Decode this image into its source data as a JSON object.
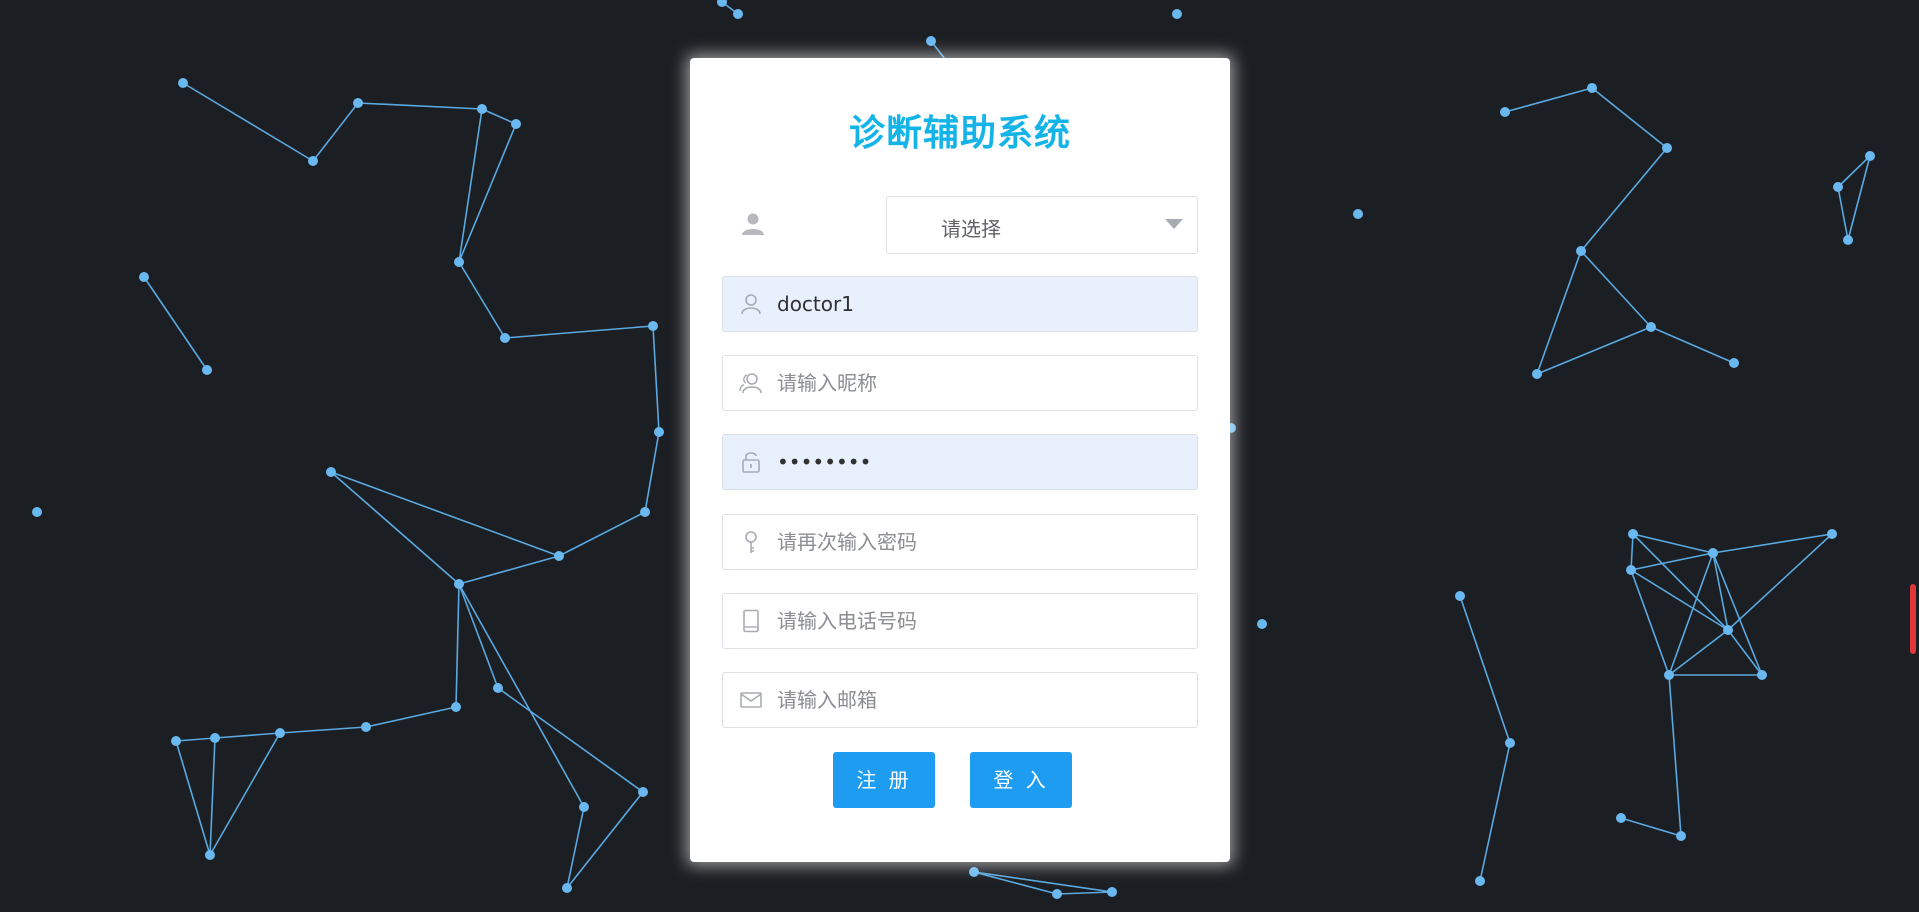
{
  "app": {
    "title": "诊断辅助系统"
  },
  "role_select": {
    "value": "请选择",
    "icon": "user-solid-icon"
  },
  "fields": {
    "username": {
      "value": "doctor1",
      "placeholder": "",
      "icon": "user-icon"
    },
    "nickname": {
      "value": "",
      "placeholder": "请输入昵称",
      "icon": "users-icon"
    },
    "password": {
      "value": "••••••••",
      "placeholder": "",
      "icon": "lock-icon"
    },
    "confirm_password": {
      "value": "",
      "placeholder": "请再次输入密码",
      "icon": "key-icon"
    },
    "phone": {
      "value": "",
      "placeholder": "请输入电话号码",
      "icon": "phone-icon"
    },
    "email": {
      "value": "",
      "placeholder": "请输入邮箱",
      "icon": "mail-icon"
    }
  },
  "buttons": {
    "register": "注 册",
    "login": "登 入"
  },
  "colors": {
    "background": "#1b1e22",
    "node": "#6ab8f0",
    "title": "#14b4e8",
    "button": "#1e9cf2",
    "filled_input": "#e8effd"
  }
}
